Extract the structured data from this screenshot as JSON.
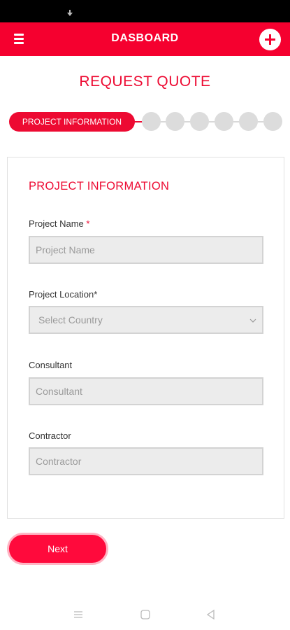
{
  "app_bar": {
    "title": "DASBOARD"
  },
  "page": {
    "title": "REQUEST QUOTE"
  },
  "stepper": {
    "active_label": "PROJECT INFORMATION",
    "total_steps": 7,
    "current_step": 1
  },
  "form": {
    "section_title": "PROJECT INFORMATION",
    "fields": [
      {
        "label": "Project Name ",
        "required_mark": "*",
        "placeholder": "Project Name"
      },
      {
        "label": "Project Location*",
        "required_mark": "",
        "placeholder": "Select Country"
      },
      {
        "label": "Consultant",
        "required_mark": "",
        "placeholder": "Consultant"
      },
      {
        "label": "Contractor",
        "required_mark": "",
        "placeholder": "Contractor"
      }
    ]
  },
  "actions": {
    "next_label": "Next"
  },
  "colors": {
    "brand": "#f5002f",
    "accent": "#ed0a32",
    "input_bg": "#ececec"
  },
  "icons": [
    "download-icon",
    "menu-icon",
    "plus-icon",
    "chevron-down-icon",
    "recent-apps-icon",
    "home-icon",
    "back-icon"
  ]
}
